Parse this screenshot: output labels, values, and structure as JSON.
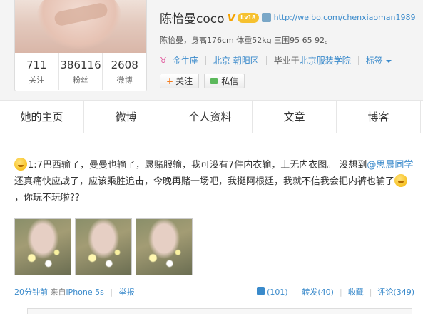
{
  "profile": {
    "name": "陈怡曼coco",
    "verified_badge": "V",
    "level_badge": "Lv18",
    "url": "http://weibo.com/chenxiaoman1989",
    "bio": "陈怡曼，身高176cm 体重52kg 三围95 65 92。",
    "stats": [
      {
        "num": "711",
        "label": "关注"
      },
      {
        "num": "386116",
        "label": "粉丝"
      },
      {
        "num": "2608",
        "label": "微博"
      }
    ],
    "tags": {
      "zodiac": "金牛座",
      "location": "北京 朝阳区",
      "school_prefix": "毕业于",
      "school": "北京服装学院",
      "tags_label": "标签"
    },
    "follow_label": "关注",
    "message_label": "私信"
  },
  "tabs": [
    "她的主页",
    "微博",
    "个人资料",
    "文章",
    "博客"
  ],
  "post": {
    "text_1": "1:7巴西输了，曼曼也输了，愿赌服输，我可没有7件内衣输，上无内衣图。 没想到",
    "mention": "@思晨同学",
    "text_2": " 还真痛快应战了，应该乘胜追击，今晚再赌一场吧，我挺阿根廷，我就不信我会把内裤也输了",
    "text_3": "，你玩不玩啦??",
    "time": "20分钟前",
    "source_prefix": "来自",
    "source": "iPhone 5s",
    "report": "举报",
    "likes": "(101)",
    "forward": "转发(40)",
    "favorite": "收藏",
    "comment": "评论(349)"
  }
}
